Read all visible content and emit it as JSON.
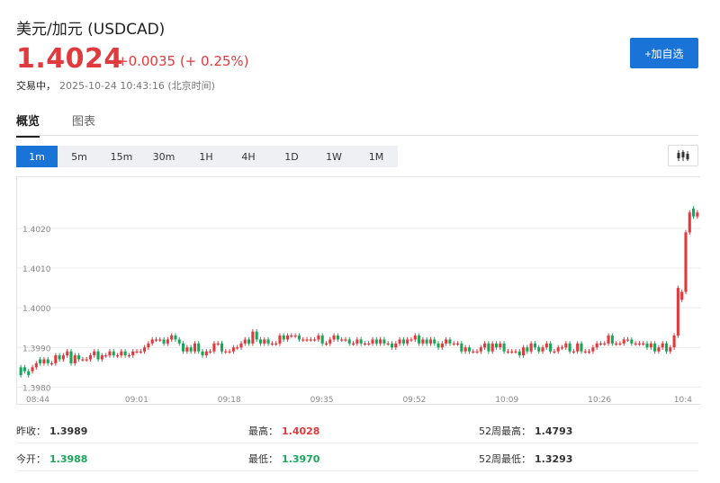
{
  "header": {
    "title": "美元/加元 (USDCAD)",
    "price": "1.4024",
    "change": "+0.0035 (+ 0.25%)",
    "status_label": "交易中，",
    "timestamp": "2025-10-24 10:43:16 (北京时间)",
    "add_button": "+加自选"
  },
  "tabs": [
    {
      "label": "概览",
      "active": true
    },
    {
      "label": "图表",
      "active": false
    }
  ],
  "intervals": [
    {
      "label": "1m",
      "active": true
    },
    {
      "label": "5m",
      "active": false
    },
    {
      "label": "15m",
      "active": false
    },
    {
      "label": "30m",
      "active": false
    },
    {
      "label": "1H",
      "active": false
    },
    {
      "label": "4H",
      "active": false
    },
    {
      "label": "1D",
      "active": false
    },
    {
      "label": "1W",
      "active": false
    },
    {
      "label": "1M",
      "active": false
    }
  ],
  "chart_toggle_icon": "candlestick-icon",
  "colors": {
    "up": "#e0393e",
    "down": "#1aa65a",
    "accent": "#1a73d6"
  },
  "chart_data": {
    "type": "candlestick",
    "y_ticks": [
      "1.4020",
      "1.4010",
      "1.4000",
      "1.3990",
      "1.3980"
    ],
    "y_tick_values": [
      1.402,
      1.401,
      1.4,
      1.399,
      1.398
    ],
    "ylim": [
      1.39785,
      1.4032
    ],
    "x_ticks": [
      "08:44",
      "09:01",
      "09:18",
      "09:35",
      "09:52",
      "10:09",
      "10:26",
      "10:4"
    ],
    "grid": true,
    "legend": "none",
    "close": [
      1.3983,
      1.3984,
      1.3983,
      1.3985,
      1.3986,
      1.3986,
      1.3987,
      1.3986,
      1.3986,
      1.3988,
      1.3987,
      1.3988,
      1.3989,
      1.3986,
      1.3988,
      1.3987,
      1.3987,
      1.3987,
      1.3988,
      1.3989,
      1.3987,
      1.3988,
      1.3988,
      1.3989,
      1.3988,
      1.3988,
      1.3989,
      1.3988,
      1.3988,
      1.3989,
      1.3989,
      1.3989,
      1.399,
      1.3991,
      1.3992,
      1.3992,
      1.3992,
      1.3991,
      1.3992,
      1.3993,
      1.3992,
      1.3991,
      1.3989,
      1.399,
      1.3989,
      1.3991,
      1.3989,
      1.3988,
      1.3989,
      1.3989,
      1.3991,
      1.3991,
      1.3989,
      1.3989,
      1.3989,
      1.399,
      1.399,
      1.3991,
      1.3992,
      1.3991,
      1.3994,
      1.3992,
      1.3991,
      1.3992,
      1.3991,
      1.3991,
      1.3991,
      1.3993,
      1.3992,
      1.3993,
      1.3993,
      1.3993,
      1.3992,
      1.3992,
      1.3992,
      1.3992,
      1.3992,
      1.3993,
      1.3991,
      1.3991,
      1.3992,
      1.3993,
      1.3992,
      1.3992,
      1.3992,
      1.3991,
      1.3991,
      1.3992,
      1.3991,
      1.3991,
      1.3991,
      1.3992,
      1.3991,
      1.3992,
      1.3991,
      1.3991,
      1.399,
      1.3991,
      1.3992,
      1.3991,
      1.3992,
      1.3992,
      1.3993,
      1.3991,
      1.3992,
      1.3991,
      1.3992,
      1.3991,
      1.399,
      1.3991,
      1.3992,
      1.3991,
      1.3991,
      1.3991,
      1.3989,
      1.399,
      1.3989,
      1.3989,
      1.3989,
      1.399,
      1.3991,
      1.3989,
      1.3991,
      1.399,
      1.3991,
      1.3989,
      1.3989,
      1.3989,
      1.3989,
      1.3988,
      1.399,
      1.3989,
      1.3991,
      1.399,
      1.3989,
      1.399,
      1.3991,
      1.3989,
      1.3989,
      1.399,
      1.399,
      1.3991,
      1.3989,
      1.3989,
      1.3991,
      1.3989,
      1.3989,
      1.3989,
      1.399,
      1.3991,
      1.3991,
      1.3991,
      1.3993,
      1.3991,
      1.3991,
      1.3991,
      1.3992,
      1.3992,
      1.3991,
      1.3991,
      1.3991,
      1.3991,
      1.399,
      1.3991,
      1.3989,
      1.399,
      1.3991,
      1.3989,
      1.399,
      1.3993,
      1.4005,
      1.4004,
      1.4019,
      1.4024,
      1.4023,
      1.4024
    ],
    "open": [
      1.3985,
      1.3985,
      1.3984,
      1.3984,
      1.3985,
      1.3987,
      1.3986,
      1.3987,
      1.3986,
      1.3986,
      1.3988,
      1.3987,
      1.3988,
      1.3989,
      1.3986,
      1.3988,
      1.3987,
      1.3987,
      1.3987,
      1.3988,
      1.3989,
      1.3987,
      1.3988,
      1.3988,
      1.3989,
      1.3988,
      1.3988,
      1.3989,
      1.3988,
      1.3988,
      1.3989,
      1.3989,
      1.3989,
      1.399,
      1.3991,
      1.3992,
      1.3992,
      1.3992,
      1.3991,
      1.3992,
      1.3993,
      1.3992,
      1.3991,
      1.3989,
      1.399,
      1.3989,
      1.3991,
      1.3989,
      1.3988,
      1.3989,
      1.3989,
      1.3991,
      1.3991,
      1.3989,
      1.3989,
      1.3989,
      1.399,
      1.399,
      1.3991,
      1.3992,
      1.3991,
      1.3994,
      1.3992,
      1.3991,
      1.3992,
      1.3991,
      1.3991,
      1.3991,
      1.3993,
      1.3992,
      1.3993,
      1.3993,
      1.3993,
      1.3992,
      1.3992,
      1.3992,
      1.3992,
      1.3992,
      1.3993,
      1.3991,
      1.3991,
      1.3992,
      1.3993,
      1.3992,
      1.3992,
      1.3992,
      1.3991,
      1.3991,
      1.3992,
      1.3991,
      1.3991,
      1.3991,
      1.3992,
      1.3991,
      1.3992,
      1.3991,
      1.3991,
      1.399,
      1.3991,
      1.3992,
      1.3991,
      1.3992,
      1.3992,
      1.3993,
      1.3991,
      1.3992,
      1.3991,
      1.3992,
      1.3991,
      1.399,
      1.3991,
      1.3992,
      1.3991,
      1.3991,
      1.3991,
      1.3989,
      1.399,
      1.3989,
      1.3989,
      1.3989,
      1.399,
      1.3991,
      1.3989,
      1.3991,
      1.399,
      1.3991,
      1.3989,
      1.3989,
      1.3989,
      1.3989,
      1.3988,
      1.399,
      1.3989,
      1.3991,
      1.399,
      1.3989,
      1.399,
      1.3991,
      1.3989,
      1.3989,
      1.399,
      1.399,
      1.3991,
      1.3989,
      1.3989,
      1.3991,
      1.3989,
      1.3989,
      1.3989,
      1.399,
      1.3991,
      1.3991,
      1.3991,
      1.3993,
      1.3991,
      1.3991,
      1.3991,
      1.3992,
      1.3992,
      1.3991,
      1.3991,
      1.3991,
      1.3991,
      1.399,
      1.3991,
      1.3989,
      1.399,
      1.3991,
      1.3989,
      1.399,
      1.3993,
      1.4002,
      1.4004,
      1.4019,
      1.4025,
      1.4023
    ]
  },
  "stats": [
    [
      {
        "label": "昨收：",
        "value": "1.3989",
        "color": "neutral"
      },
      {
        "label": "最高：",
        "value": "1.4028",
        "color": "up"
      },
      {
        "label": "52周最高：",
        "value": "1.4793",
        "color": "neutral"
      }
    ],
    [
      {
        "label": "今开：",
        "value": "1.3988",
        "color": "down"
      },
      {
        "label": "最低：",
        "value": "1.3970",
        "color": "down"
      },
      {
        "label": "52周最低：",
        "value": "1.3293",
        "color": "neutral"
      }
    ]
  ]
}
